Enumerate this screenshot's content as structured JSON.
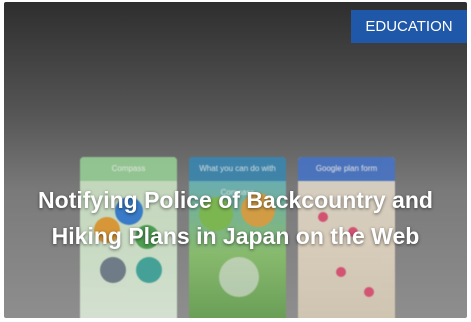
{
  "category_badge": {
    "label": "EDUCATION",
    "color": "#1f58a8"
  },
  "article": {
    "title": "Notifying Police of Backcountry and Hiking Plans in Japan on the Web"
  },
  "phones": [
    {
      "header": "Compass"
    },
    {
      "header": "What you can do with Compass"
    },
    {
      "header": "Google plan form"
    }
  ]
}
